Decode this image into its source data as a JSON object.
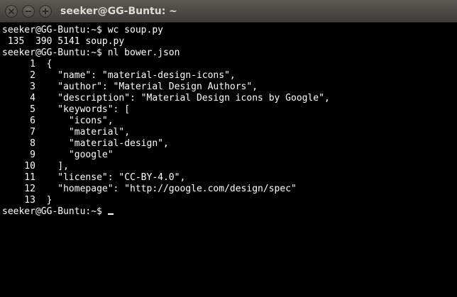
{
  "window": {
    "title": "seeker@GG-Buntu: ~"
  },
  "titlebar_buttons": {
    "close": "close-icon",
    "minimize": "minimize-icon",
    "maximize": "maximize-icon"
  },
  "terminal": {
    "lines": [
      "seeker@GG-Buntu:~$ wc soup.py",
      " 135  390 5141 soup.py",
      "seeker@GG-Buntu:~$ nl bower.json",
      "     1\t{",
      "     2\t  \"name\": \"material-design-icons\",",
      "     3\t  \"author\": \"Material Design Authors\",",
      "     4\t  \"description\": \"Material Design icons by Google\",",
      "     5\t  \"keywords\": [",
      "     6\t    \"icons\",",
      "     7\t    \"material\",",
      "     8\t    \"material-design\",",
      "     9\t    \"google\"",
      "    10\t  ],",
      "    11\t  \"license\": \"CC-BY-4.0\",",
      "    12\t  \"homepage\": \"http://google.com/design/spec\"",
      "    13\t}"
    ],
    "prompt": "seeker@GG-Buntu:~$ "
  },
  "colors": {
    "background": "#000000",
    "foreground": "#ffffff",
    "titlebar": "#4a4945",
    "title_text": "#dfdbd2"
  }
}
